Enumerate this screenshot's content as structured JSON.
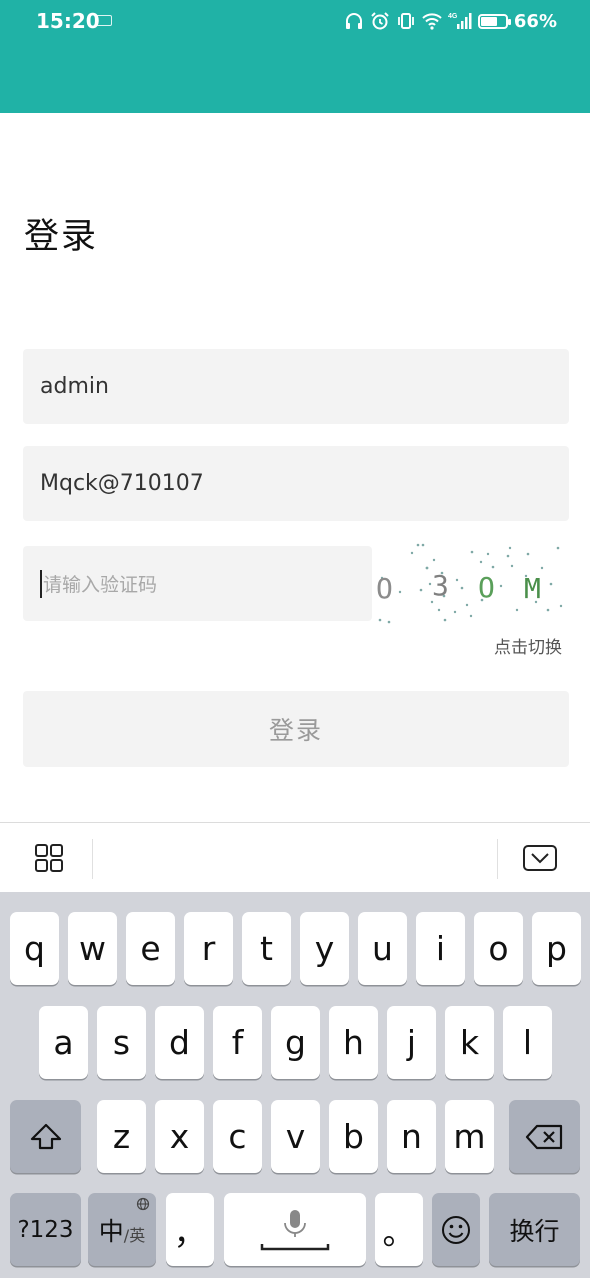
{
  "status_bar": {
    "time": "15:20",
    "battery_text": "66%",
    "battery_level": 0.66,
    "network": "4G",
    "icons": [
      "keyboard-icon",
      "headphones-icon",
      "alarm-icon",
      "vibrate-icon",
      "wifi-icon",
      "signal-icon",
      "battery-icon"
    ],
    "color": "#20b2a6"
  },
  "page": {
    "title": "登录"
  },
  "form": {
    "username_value": "admin",
    "password_value": "Mqck@710107",
    "captcha_placeholder": "请输入验证码",
    "captcha_chars": [
      "O",
      "3",
      "O",
      "M"
    ],
    "captcha_switch": "点击切换",
    "login_label": "登录"
  },
  "keyboard": {
    "toolbar_icons": [
      "grid-icon",
      "keyboard-hide-icon"
    ],
    "row1": [
      "q",
      "w",
      "e",
      "r",
      "t",
      "y",
      "u",
      "i",
      "o",
      "p"
    ],
    "row2": [
      "a",
      "s",
      "d",
      "f",
      "g",
      "h",
      "j",
      "k",
      "l"
    ],
    "row3": [
      "z",
      "x",
      "c",
      "v",
      "b",
      "n",
      "m"
    ],
    "num_label": "?123",
    "lang_main": "中",
    "lang_sub": "/英",
    "comma": "，",
    "period": "。",
    "enter_label": "换行"
  }
}
